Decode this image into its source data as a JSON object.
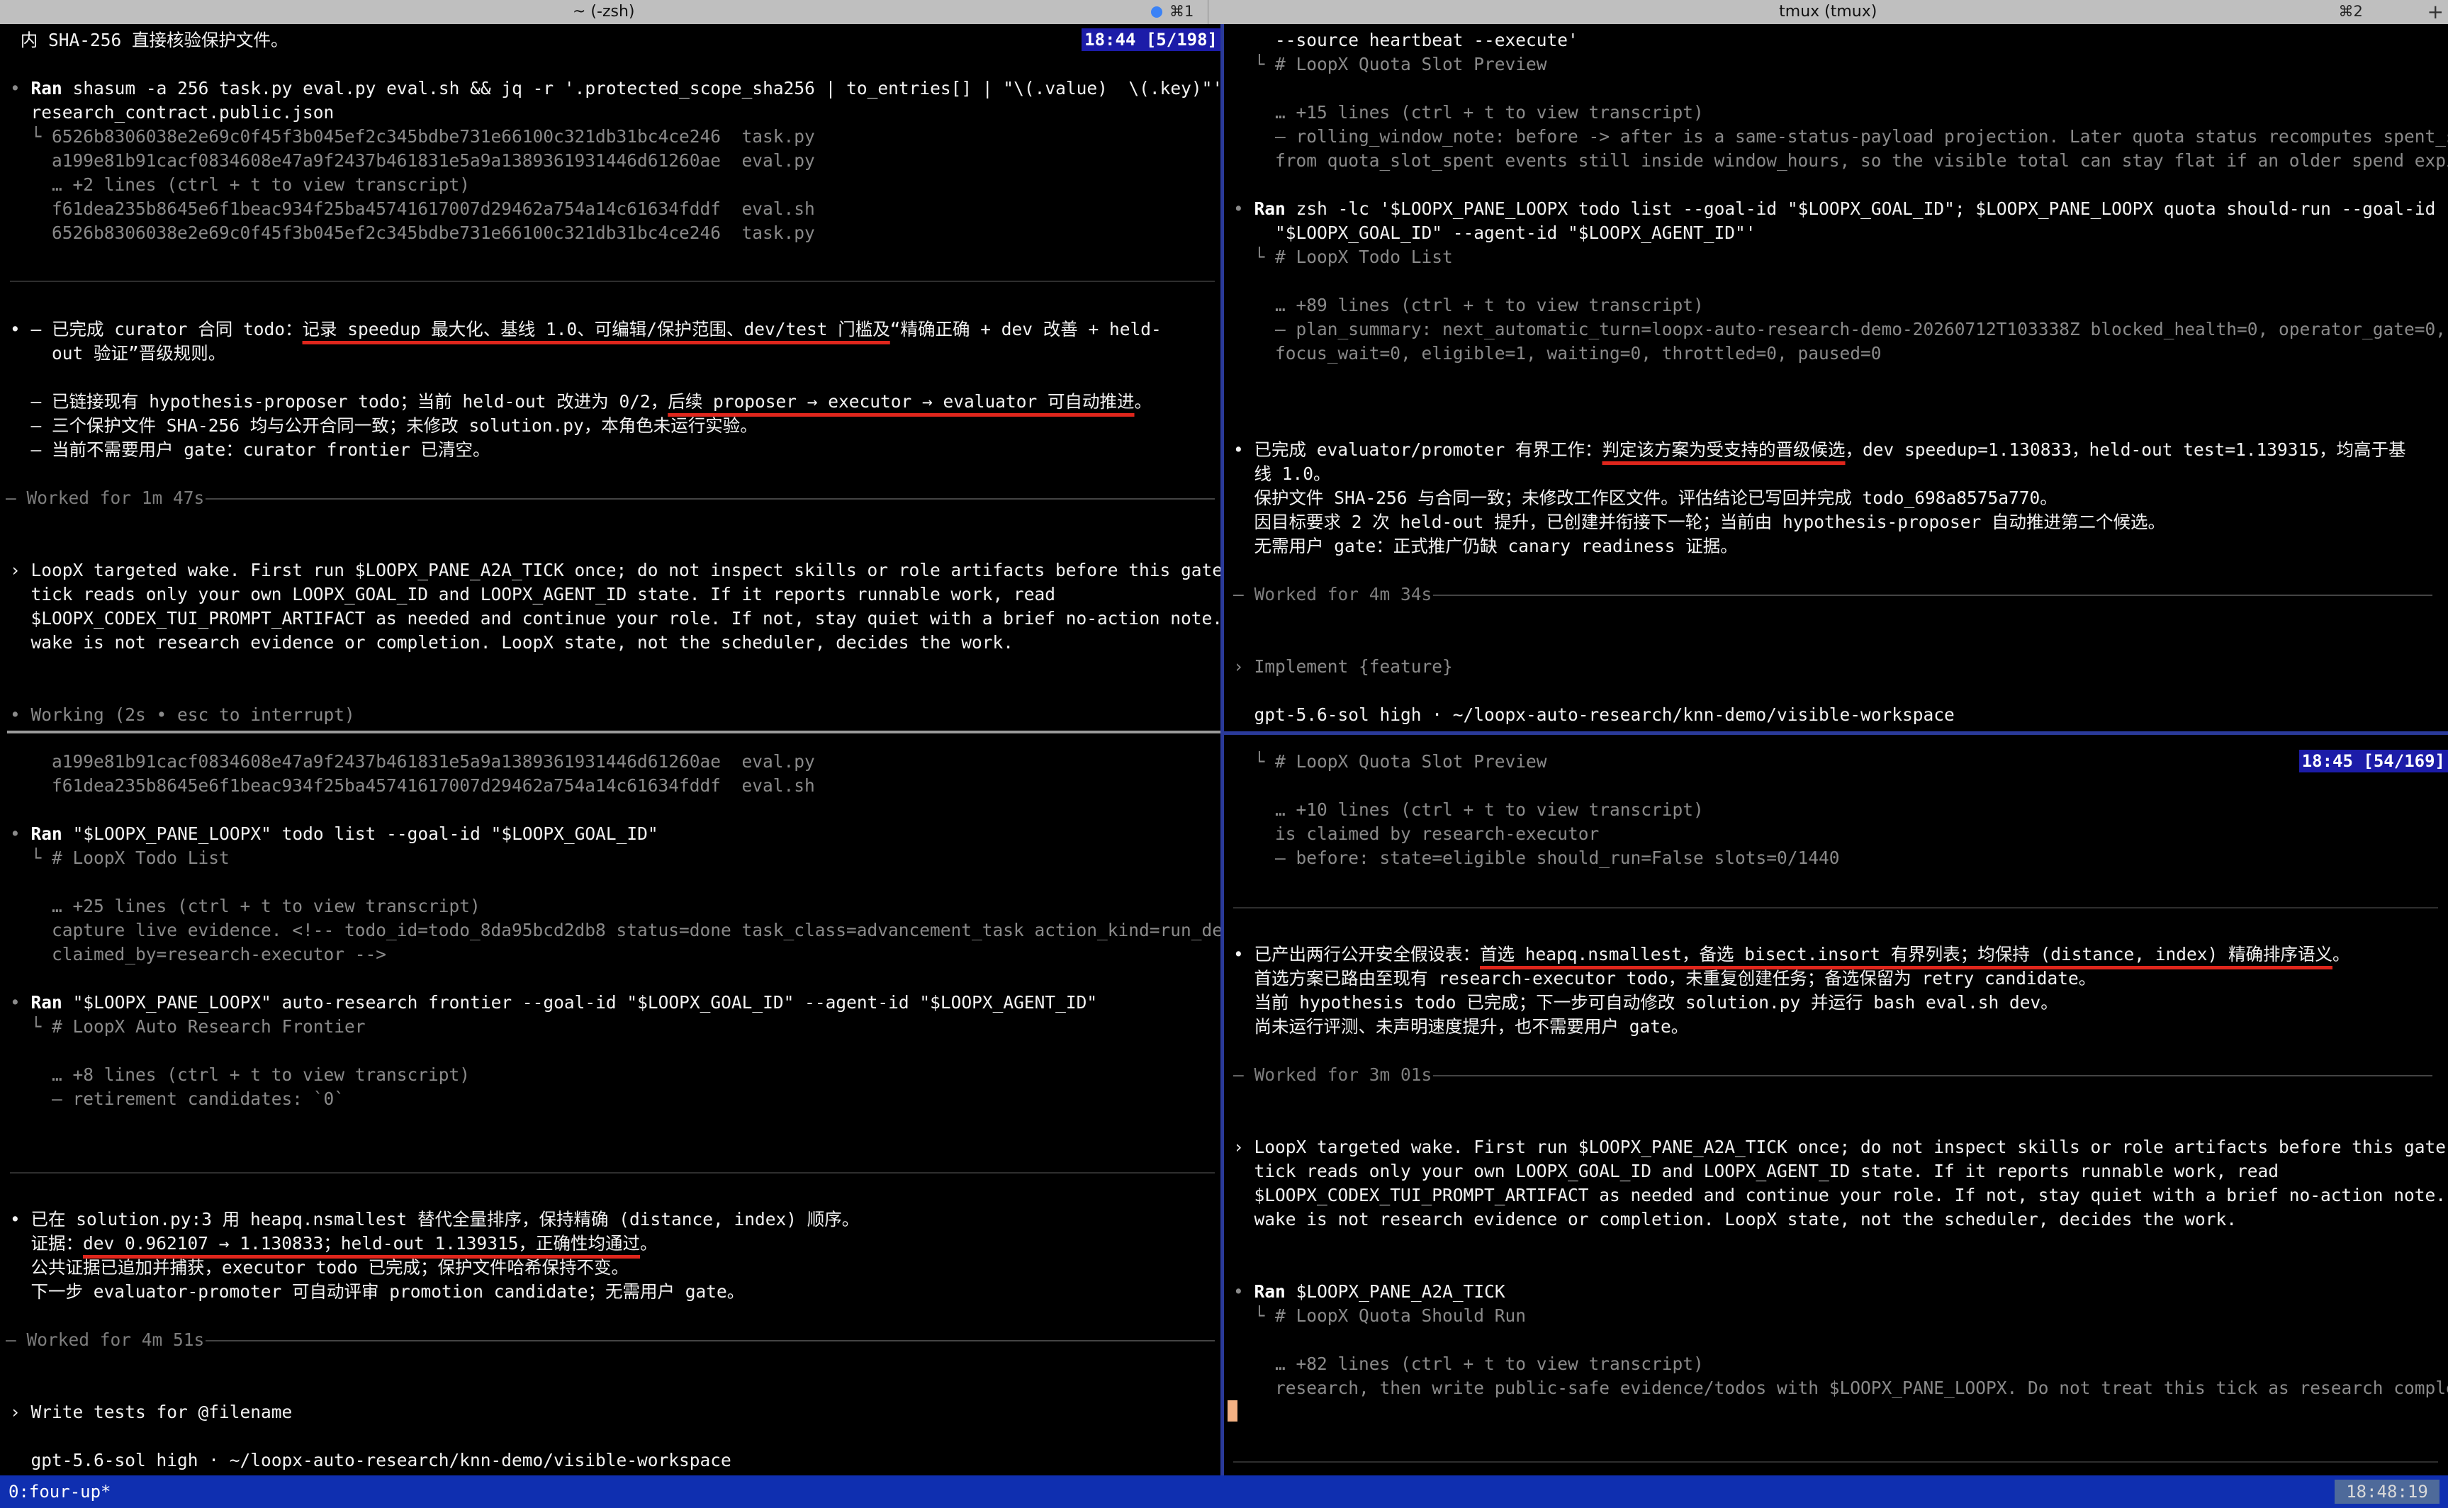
{
  "tabs": {
    "left_title": "~ (-zsh)",
    "left_shortcut": "⌘1",
    "right_title": "tmux (tmux)",
    "right_shortcut": "⌘2",
    "plus": "+"
  },
  "pane_tl": {
    "badge": "18:44 [5/198]",
    "l0": " 内 SHA-256 直接核验保护文件。",
    "ran1_cmd": "shasum -a 256 task.py eval.py eval.sh && jq -r '.protected_scope_sha256 | to_entries[] | \"\\(.value)  \\(.key)\"'",
    "ran1_cont": "  research_contract.public.json",
    "ran1_o1": "  └ 6526b8306038e2e69c0f45f3b045ef2c345bdbe731e66100c321db31bc4ce246  task.py",
    "ran1_o2": "    a199e81b91cacf0834608e47a9f2437b461831e5a9a1389361931446d61260ae  eval.py",
    "ran1_o3": "    … +2 lines (ctrl + t to view transcript)",
    "ran1_o4": "    f61dea235b8645e6f1beac934f25ba45741617007d29462a754a14c61634fddf  eval.sh",
    "ran1_o5": "    6526b8306038e2e69c0f45f3b045ef2c345bdbe731e66100c321db31bc4ce246  task.py",
    "b1_pre": "• – 已完成 curator 合同 todo：",
    "b1_ul": "记录 speedup 最大化、基线 1.0、可编辑/保护范围、dev/test 门槛及",
    "b1_post": "“精确正确 + dev 改善 + held-",
    "b1_cont": "    out 验证”晋级规则。",
    "b2_pre": "  – 已链接现有 hypothesis-proposer todo；当前 held-out 改进为 0/2，",
    "b2_ul": "后续 proposer → executor → evaluator 可自动推进",
    "b2_post": "。",
    "b3": "  – 三个保护文件 SHA-256 均与公开合同一致；未修改 solution.py，本角色未运行实验。",
    "b4": "  – 当前不需要用户 gate：curator frontier 已清空。",
    "worked": "– Worked for 1m 47s ",
    "wake1": "› LoopX targeted wake. First run $LOOPX_PANE_A2A_TICK once; do not inspect skills or role artifacts before this gate. The",
    "wake2": "  tick reads only your own LOOPX_GOAL_ID and LOOPX_AGENT_ID state. If it reports runnable work, read",
    "wake3": "  $LOOPX_CODEX_TUI_PROMPT_ARTIFACT as needed and continue your role. If not, stay quiet with a brief no-action note. This",
    "wake4": "  wake is not research evidence or completion. LoopX state, not the scheduler, decides the work.",
    "working": "• Working (2s • esc to interrupt)"
  },
  "pane_bl": {
    "o1": "    a199e81b91cacf0834608e47a9f2437b461831e5a9a1389361931446d61260ae  eval.py",
    "o2": "    f61dea235b8645e6f1beac934f25ba45741617007d29462a754a14c61634fddf  eval.sh",
    "ran2_cmd": "\"$LOOPX_PANE_LOOPX\" todo list --goal-id \"$LOOPX_GOAL_ID\"",
    "r2o1": "  └ # LoopX Todo List",
    "r2o2": "    … +25 lines (ctrl + t to view transcript)",
    "r2o3": "    capture live evidence. <!-- todo_id=todo_8da95bcd2db8 status=done task_class=advancement_task action_kind=run_dev_eval",
    "r2o4": "    claimed_by=research-executor -->",
    "ran3_cmd": "\"$LOOPX_PANE_LOOPX\" auto-research frontier --goal-id \"$LOOPX_GOAL_ID\" --agent-id \"$LOOPX_AGENT_ID\"",
    "r3o1": "  └ # LoopX Auto Research Frontier",
    "r3o2": "    … +8 lines (ctrl + t to view transcript)",
    "r3o3": "    – retirement candidates: `0`",
    "c1": "• 已在 solution.py:3 用 heapq.nsmallest 替代全量排序，保持精确 (distance, index) 顺序。",
    "c2_pre": "  证据：",
    "c2_ul": "dev 0.962107 → 1.130833；held-out 1.139315，正确性均通过",
    "c2_post": "。",
    "c3": "  公共证据已追加并捕获，executor todo 已完成；保护文件哈希保持不变。",
    "c4": "  下一步 evaluator-promoter 可自动评审 promotion candidate；无需用户 gate。",
    "worked": "– Worked for 4m 51s ",
    "prompt": "› Write tests for @filename",
    "model": "  gpt-5.6-sol high · ~/loopx-auto-research/knn-demo/visible-workspace"
  },
  "pane_tr": {
    "l1": "    --source heartbeat --execute'",
    "l2": "  └ # LoopX Quota Slot Preview",
    "l3": "    … +15 lines (ctrl + t to view transcript)",
    "l4": "    – rolling_window_note: before -> after is a same-status-payload projection. Later quota status recomputes spent_slots",
    "l5": "    from quota_slot_spent events still inside window_hours, so the visible total can stay flat if an older spend expires.",
    "ran_cmd": "zsh -lc '$LOOPX_PANE_LOOPX todo list --goal-id \"$LOOPX_GOAL_ID\"; $LOOPX_PANE_LOOPX quota should-run --goal-id",
    "ran_cont": "    \"$LOOPX_GOAL_ID\" --agent-id \"$LOOPX_AGENT_ID\"'",
    "o1": "  └ # LoopX Todo List",
    "o2": "    … +89 lines (ctrl + t to view transcript)",
    "o3": "    – plan_summary: next_automatic_turn=loopx-auto-research-demo-20260712T103338Z blocked_health=0, operator_gate=0,",
    "o4": "    focus_wait=0, eligible=1, waiting=0, throttled=0, paused=0",
    "e1_pre": "• 已完成 evaluator/promoter 有界工作：",
    "e1_ul": "判定该方案为受支持的晋级候选",
    "e1_post": "，dev speedup=1.130833，held-out test=1.139315，均高于基",
    "e1_cont": "  线 1.0。",
    "e2": "  保护文件 SHA-256 与合同一致；未修改工作区文件。评估结论已写回并完成 todo_698a8575a770。",
    "e3": "  因目标要求 2 次 held-out 提升，已创建并衔接下一轮；当前由 hypothesis-proposer 自动推进第二个候选。",
    "e4": "  无需用户 gate：正式推广仍缺 canary readiness 证据。",
    "worked": "– Worked for 4m 34s ",
    "prompt": "› Implement {feature}",
    "model": "  gpt-5.6-sol high · ~/loopx-auto-research/knn-demo/visible-workspace"
  },
  "pane_br": {
    "badge": "18:45 [54/169]",
    "l1": "  └ # LoopX Quota Slot Preview",
    "l2": "    … +10 lines (ctrl + t to view transcript)",
    "l3": "    is claimed by research-executor",
    "l4": "    – before: state=eligible should_run=False slots=0/1440",
    "p1_pre": "• 已产出两行公开安全假设表：",
    "p1_ul": "首选 heapq.nsmallest，备选 bisect.insort 有界列表；均保持 (distance, index) 精确排序语义",
    "p1_post": "。",
    "p2": "  首选方案已路由至现有 research-executor todo，未重复创建任务；备选保留为 retry candidate。",
    "p3": "  当前 hypothesis todo 已完成；下一步可自动修改 solution.py 并运行 bash eval.sh dev。",
    "p4": "  尚未运行评测、未声明速度提升，也不需要用户 gate。",
    "worked": "– Worked for 3m 01s ",
    "wake1": "› LoopX targeted wake. First run $LOOPX_PANE_A2A_TICK once; do not inspect skills or role artifacts before this gate. The",
    "wake2": "  tick reads only your own LOOPX_GOAL_ID and LOOPX_AGENT_ID state. If it reports runnable work, read",
    "wake3": "  $LOOPX_CODEX_TUI_PROMPT_ARTIFACT as needed and continue your role. If not, stay quiet with a brief no-action note. This",
    "wake4": "  wake is not research evidence or completion. LoopX state, not the scheduler, decides the work.",
    "ran_cmd": "$LOOPX_PANE_A2A_TICK",
    "o1": "  └ # LoopX Quota Should Run",
    "o2": "    … +82 lines (ctrl + t to view transcript)",
    "o3": "    research, then write public-safe evidence/todos with $LOOPX_PANE_LOOPX. Do not treat this tick as research completion."
  },
  "ran_label": "Ran",
  "bullet": "•",
  "status": {
    "session": "0:four-up*",
    "clock": "18:48:19"
  },
  "colors": {
    "pane_border": "#2a3a9a",
    "status_bar": "#0f2fb0",
    "underline": "#e0261c",
    "badge": "#1c1ca8"
  }
}
